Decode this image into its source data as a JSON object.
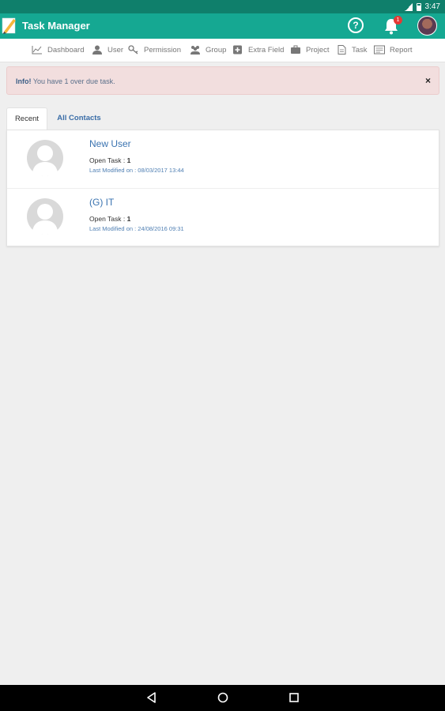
{
  "status_bar": {
    "time": "3:47"
  },
  "app_bar": {
    "title": "Task Manager",
    "help_label": "?",
    "notification_count": "1"
  },
  "nav": {
    "items": [
      {
        "label": "Dashboard",
        "icon": "line-chart-icon"
      },
      {
        "label": "User",
        "icon": "user-icon"
      },
      {
        "label": "Permission",
        "icon": "key-icon"
      },
      {
        "label": "Group",
        "icon": "group-icon"
      },
      {
        "label": "Extra Field",
        "icon": "plus-square-icon"
      },
      {
        "label": "Project",
        "icon": "briefcase-icon"
      },
      {
        "label": "Task",
        "icon": "file-icon"
      },
      {
        "label": "Report",
        "icon": "report-icon"
      }
    ]
  },
  "alert": {
    "strong": "Info!",
    "message": " You have 1 over due task.",
    "close": "×"
  },
  "tabs": [
    {
      "label": "Recent",
      "active": true
    },
    {
      "label": "All Contacts",
      "active": false
    }
  ],
  "contacts": [
    {
      "name": "New User",
      "open_task_label": "Open Task : ",
      "open_task_count": "1",
      "last_modified": "Last Modified on : 08/03/2017 13:44"
    },
    {
      "name": "(G) IT",
      "open_task_label": "Open Task : ",
      "open_task_count": "1",
      "last_modified": "Last Modified on : 24/08/2016 09:31"
    }
  ],
  "colors": {
    "status_bar": "#0f7f6b",
    "app_bar": "#15a892",
    "alert_bg": "#f2dede",
    "link_blue": "#3a73b0",
    "badge": "#e53935"
  }
}
